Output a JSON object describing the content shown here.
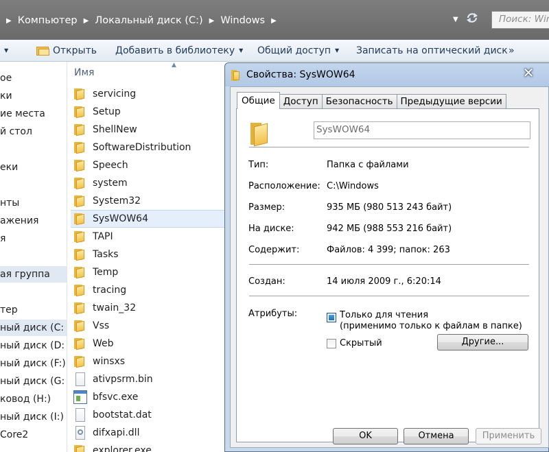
{
  "addressbar": {
    "crumbs": [
      "Компьютер",
      "Локальный диск (C:)",
      "Windows"
    ],
    "search_placeholder": "Поиск: Windows"
  },
  "toolbar": {
    "open": "Открыть",
    "add_to_library": "Добавить в библиотеку",
    "share": "Общий доступ",
    "burn": "Записать на оптический диск",
    "more": "»"
  },
  "nav": {
    "items": [
      "ое",
      "ки",
      "ие места",
      "й стол",
      "еки",
      "нты",
      "ажения",
      "я",
      "ая группа",
      "тер",
      "ный диск (C:",
      "ный диск (D:",
      "ный диск (F:)",
      "ный диск (G:",
      "ковод (H:)",
      "ный диск (I:)",
      "Core2"
    ]
  },
  "filelist": {
    "column_name": "Имя",
    "files": [
      {
        "name": "servicing",
        "type": "folder"
      },
      {
        "name": "Setup",
        "type": "folder"
      },
      {
        "name": "ShellNew",
        "type": "folder"
      },
      {
        "name": "SoftwareDistribution",
        "type": "folder"
      },
      {
        "name": "Speech",
        "type": "folder"
      },
      {
        "name": "system",
        "type": "folder"
      },
      {
        "name": "System32",
        "type": "folder"
      },
      {
        "name": "SysWOW64",
        "type": "folder",
        "selected": true
      },
      {
        "name": "TAPI",
        "type": "folder"
      },
      {
        "name": "Tasks",
        "type": "folder"
      },
      {
        "name": "Temp",
        "type": "folder"
      },
      {
        "name": "tracing",
        "type": "folder"
      },
      {
        "name": "twain_32",
        "type": "folder"
      },
      {
        "name": "Vss",
        "type": "folder"
      },
      {
        "name": "Web",
        "type": "folder"
      },
      {
        "name": "winsxs",
        "type": "folder"
      },
      {
        "name": "ativpsrm.bin",
        "type": "file"
      },
      {
        "name": "bfsvc.exe",
        "type": "exe"
      },
      {
        "name": "bootstat.dat",
        "type": "file"
      },
      {
        "name": "difxapi.dll",
        "type": "dll"
      },
      {
        "name": "explorer.exe",
        "type": "folder"
      }
    ]
  },
  "dialog": {
    "title": "Свойства: SysWOW64",
    "close": "✕",
    "tabs": [
      "Общие",
      "Доступ",
      "Безопасность",
      "Предыдущие версии"
    ],
    "folder_name": "SysWOW64",
    "props": {
      "type_label": "Тип:",
      "type_value": "Папка с файлами",
      "location_label": "Расположение:",
      "location_value": "C:\\Windows",
      "size_label": "Размер:",
      "size_value": "935 МБ (980 513 243 байт)",
      "ondisk_label": "На диске:",
      "ondisk_value": "942 МБ (988 553 216 байт)",
      "contains_label": "Содержит:",
      "contains_value": "Файлов: 4 399; папок: 263",
      "created_label": "Создан:",
      "created_value": "14 июля 2009 г., 6:20:14",
      "attributes_label": "Атрибуты:"
    },
    "readonly_label": "Только для чтения",
    "readonly_sub": "(применимо только к файлам в папке)",
    "hidden_label": "Скрытый",
    "other_button": "Другие...",
    "ok": "OK",
    "cancel": "Отмена",
    "apply": "Применить"
  }
}
